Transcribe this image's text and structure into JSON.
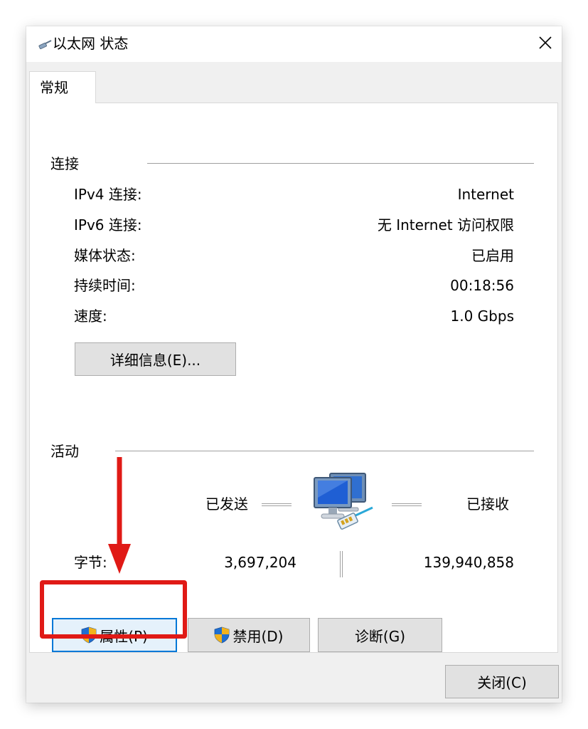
{
  "window": {
    "title": "以太网 状态"
  },
  "tabs": [
    {
      "label": "常规"
    }
  ],
  "connection": {
    "section_title": "连接",
    "rows": [
      {
        "label": "IPv4 连接:",
        "value": "Internet"
      },
      {
        "label": "IPv6 连接:",
        "value": "无 Internet 访问权限"
      },
      {
        "label": "媒体状态:",
        "value": "已启用"
      },
      {
        "label": "持续时间:",
        "value": "00:18:56"
      },
      {
        "label": "速度:",
        "value": "1.0 Gbps"
      }
    ],
    "details_button": "详细信息(E)..."
  },
  "activity": {
    "section_title": "活动",
    "sent_label": "已发送",
    "received_label": "已接收",
    "bytes_label": "字节:",
    "bytes_sent": "3,697,204",
    "bytes_received": "139,940,858"
  },
  "buttons": {
    "properties": "属性(P)",
    "disable": "禁用(D)",
    "diagnose": "诊断(G)",
    "close": "关闭(C)"
  },
  "colors": {
    "annotation_red": "#e01a16",
    "focus_blue": "#0078d7",
    "button_face": "#e1e1e1",
    "dialog_bg": "#f0f0f0"
  },
  "icons": [
    "ethernet-icon",
    "close-icon",
    "network-computers-icon",
    "uac-shield-icon",
    "arrow-down-icon"
  ]
}
